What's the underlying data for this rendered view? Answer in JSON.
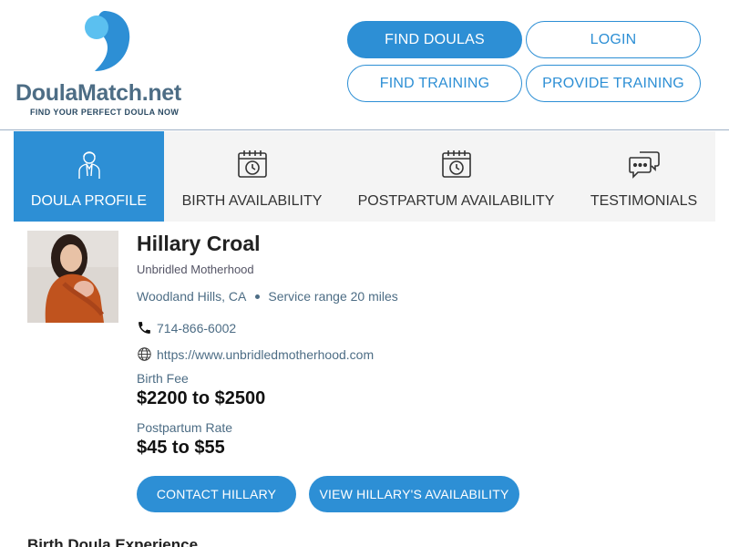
{
  "brand": {
    "name": "DoulaMatch",
    "tld": ".net",
    "tagline": "FIND YOUR PERFECT DOULA NOW",
    "logo_icon": "doula-logo-icon",
    "colors": {
      "primary": "#2d8fd5",
      "text": "#4d6d85",
      "light_blue": "#5bc0f0"
    }
  },
  "header_nav": {
    "find_doulas": "FIND DOULAS",
    "login": "LOGIN",
    "find_training": "FIND TRAINING",
    "provide_training": "PROVIDE TRAINING"
  },
  "tabs": [
    {
      "label": "DOULA PROFILE",
      "icon": "doula-profile-icon",
      "active": true
    },
    {
      "label": "BIRTH AVAILABILITY",
      "icon": "calendar-clock-icon",
      "active": false
    },
    {
      "label": "POSTPARTUM AVAILABILITY",
      "icon": "calendar-clock-icon",
      "active": false
    },
    {
      "label": "TESTIMONIALS",
      "icon": "chat-bubbles-icon",
      "active": false
    }
  ],
  "profile": {
    "name": "Hillary Croal",
    "business": "Unbridled Motherhood",
    "location": "Woodland Hills, CA",
    "service_range": "Service range 20 miles",
    "phone": "714-866-6002",
    "phone_icon": "phone-icon",
    "website": "https://www.unbridledmotherhood.com",
    "website_icon": "globe-icon",
    "birth_fee_label": "Birth Fee",
    "birth_fee": "$2200 to $2500",
    "postpartum_rate_label": "Postpartum Rate",
    "postpartum_rate": "$45 to $55"
  },
  "actions": {
    "contact": "CONTACT HILLARY",
    "availability": "VIEW HILLARY'S AVAILABILITY"
  },
  "section": {
    "birth_experience_heading": "Birth Doula Experience"
  }
}
